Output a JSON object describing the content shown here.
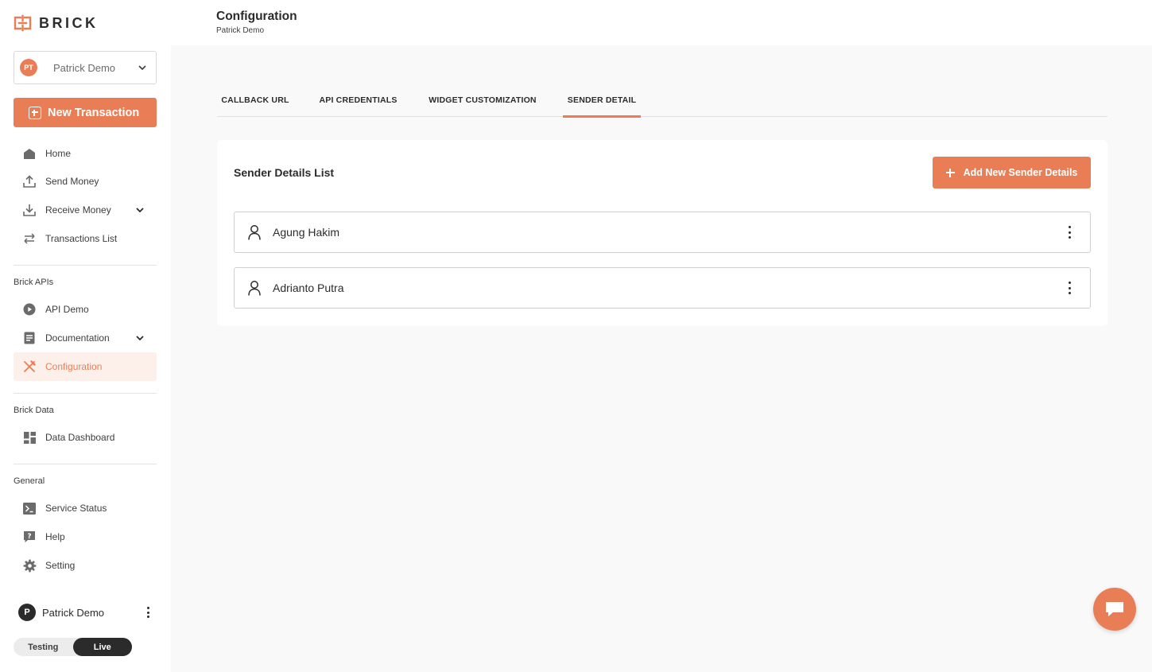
{
  "brand": {
    "name": "BRICK",
    "accent": "#e97e56"
  },
  "account": {
    "initials": "PT",
    "name": "Patrick Demo"
  },
  "new_transaction_label": "New Transaction",
  "nav": {
    "home": "Home",
    "send_money": "Send Money",
    "receive_money": "Receive Money",
    "transactions_list": "Transactions List",
    "brick_apis_title": "Brick APIs",
    "api_demo": "API Demo",
    "documentation": "Documentation",
    "configuration": "Configuration",
    "brick_data_title": "Brick Data",
    "data_dashboard": "Data Dashboard",
    "general_title": "General",
    "service_status": "Service Status",
    "help": "Help",
    "setting": "Setting"
  },
  "user": {
    "initial": "P",
    "name": "Patrick Demo"
  },
  "environment": {
    "testing": "Testing",
    "live": "Live",
    "selected": "Live"
  },
  "header": {
    "title": "Configuration",
    "subtitle": "Patrick Demo"
  },
  "tabs": [
    {
      "label": "CALLBACK URL",
      "active": false
    },
    {
      "label": "API CREDENTIALS",
      "active": false
    },
    {
      "label": "WIDGET CUSTOMIZATION",
      "active": false
    },
    {
      "label": "SENDER DETAIL",
      "active": true
    }
  ],
  "sender_card": {
    "title": "Sender Details List",
    "add_button": "Add New Sender Details",
    "senders": [
      "Agung Hakim",
      "Adrianto Putra"
    ]
  }
}
